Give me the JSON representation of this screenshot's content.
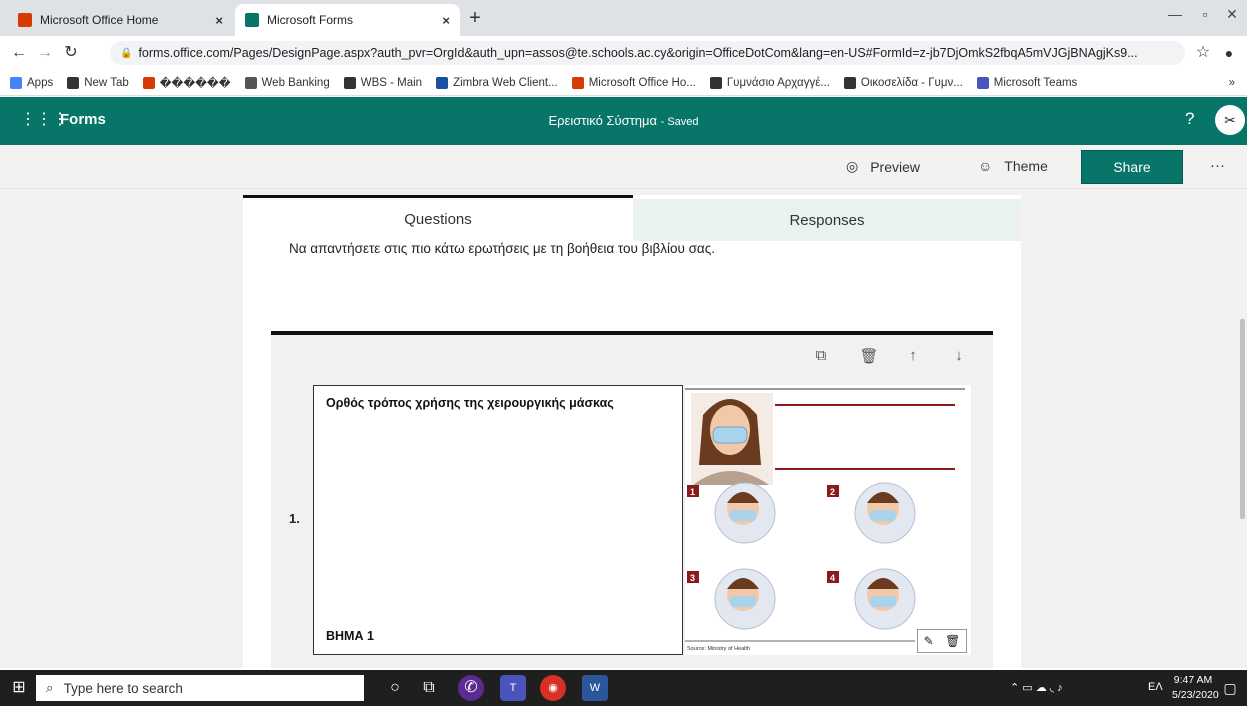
{
  "browser": {
    "tabs": [
      {
        "title": "Microsoft Office Home",
        "color": "#d83b01"
      },
      {
        "title": "Microsoft Forms",
        "color": "#077568"
      }
    ],
    "close_glyph": "×",
    "new_tab_glyph": "+",
    "window_controls": [
      "—",
      "▫",
      "✕"
    ],
    "url": "forms.office.com/Pages/DesignPage.aspx?auth_pvr=OrgId&auth_upn=assos@te.schools.ac.cy&origin=OfficeDotCom&lang=en-US#FormId=z-jb7DjOmkS2fbqA5mVJGjBNAgjKs9...",
    "bookmarks": [
      {
        "label": "Apps",
        "color": "#4285f4"
      },
      {
        "label": "New Tab",
        "color": "#333333"
      },
      {
        "label": "������",
        "color": "#d83b01"
      },
      {
        "label": "Web Banking",
        "color": "#555555"
      },
      {
        "label": "WBS - Main",
        "color": "#333333"
      },
      {
        "label": "Zimbra Web Client...",
        "color": "#1a4fa3"
      },
      {
        "label": "Microsoft Office Ho...",
        "color": "#d83b01"
      },
      {
        "label": "Γυμνάσιο Αρχαγγέ...",
        "color": "#333333"
      },
      {
        "label": "Οικοσελίδα - Γυμν...",
        "color": "#333333"
      },
      {
        "label": "Microsoft Teams",
        "color": "#4b53bc"
      }
    ],
    "more_bookmarks": "»"
  },
  "forms": {
    "app_name": "Forms",
    "form_title": "Ερειστικό Σύστημα",
    "save_status": "- Saved",
    "help": "?",
    "accent": "#077568"
  },
  "toolbar": {
    "preview_label": "Preview",
    "theme_label": "Theme",
    "share_label": "Share",
    "more": "···"
  },
  "tabs": {
    "questions": "Questions",
    "responses": "Responses"
  },
  "intro_text": "Να απαντήσετε στις πιο κάτω ερωτήσεις με τη βοήθεια του βιβλίου σας.",
  "question": {
    "number": "1.",
    "title": "Ορθός τρόπος χρήσης της χειρουργικής μάσκας",
    "step_label": "ΒΗΜΑ 1",
    "figure_steps": [
      "1",
      "2",
      "3",
      "4"
    ],
    "figure_source": "Source: Ministry of Health",
    "step_color": "#8b1a1a"
  },
  "taskbar": {
    "search_placeholder": "Type here to search",
    "tray_lang": "ΕΛ",
    "time": "9:47 AM",
    "date": "5/23/2020"
  }
}
